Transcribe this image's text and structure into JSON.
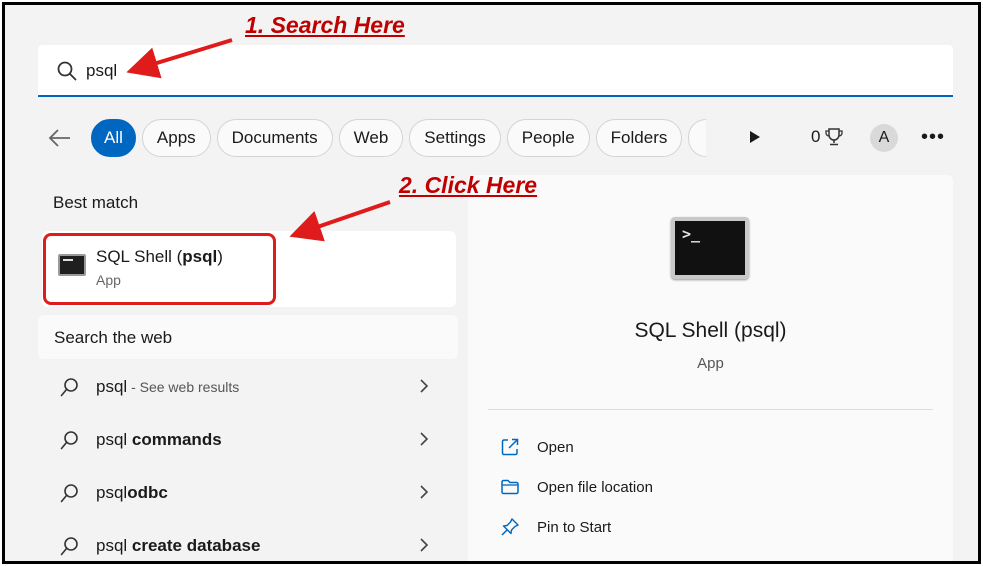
{
  "annotations": {
    "step1": "1. Search Here",
    "step2": "2. Click Here"
  },
  "search": {
    "value": "psql",
    "icon": "search-icon"
  },
  "filters": {
    "back_icon": "arrow-left-icon",
    "chips": [
      "All",
      "Apps",
      "Documents",
      "Web",
      "Settings",
      "People",
      "Folders"
    ],
    "active": "All",
    "play_icon": "play-icon",
    "points": "0",
    "points_icon": "trophy-icon",
    "avatar_initial": "A",
    "more_icon": "more-icon"
  },
  "best_match": {
    "title": "Best match",
    "app_name_prefix": "SQL Shell (",
    "app_name_bold": "psql",
    "app_name_suffix": ")",
    "app_type": "App",
    "icon": "terminal-icon"
  },
  "web": {
    "title": "Search the web",
    "items": [
      {
        "prefix": "psql",
        "bold": "",
        "hint": " - See web results"
      },
      {
        "prefix": "psql",
        "bold": " commands",
        "hint": ""
      },
      {
        "prefix": "psql",
        "bold": "odbc",
        "hint": ""
      },
      {
        "prefix": "psql",
        "bold": " create database",
        "hint": ""
      }
    ]
  },
  "detail": {
    "name": "SQL Shell (psql)",
    "type": "App",
    "prompt": ">_",
    "actions": [
      {
        "label": "Open",
        "icon": "open-external-icon"
      },
      {
        "label": "Open file location",
        "icon": "folder-icon"
      },
      {
        "label": "Pin to Start",
        "icon": "pin-icon"
      }
    ]
  },
  "colors": {
    "accent": "#0067c0",
    "annotation": "#c00000",
    "highlight": "#e01b1b"
  }
}
